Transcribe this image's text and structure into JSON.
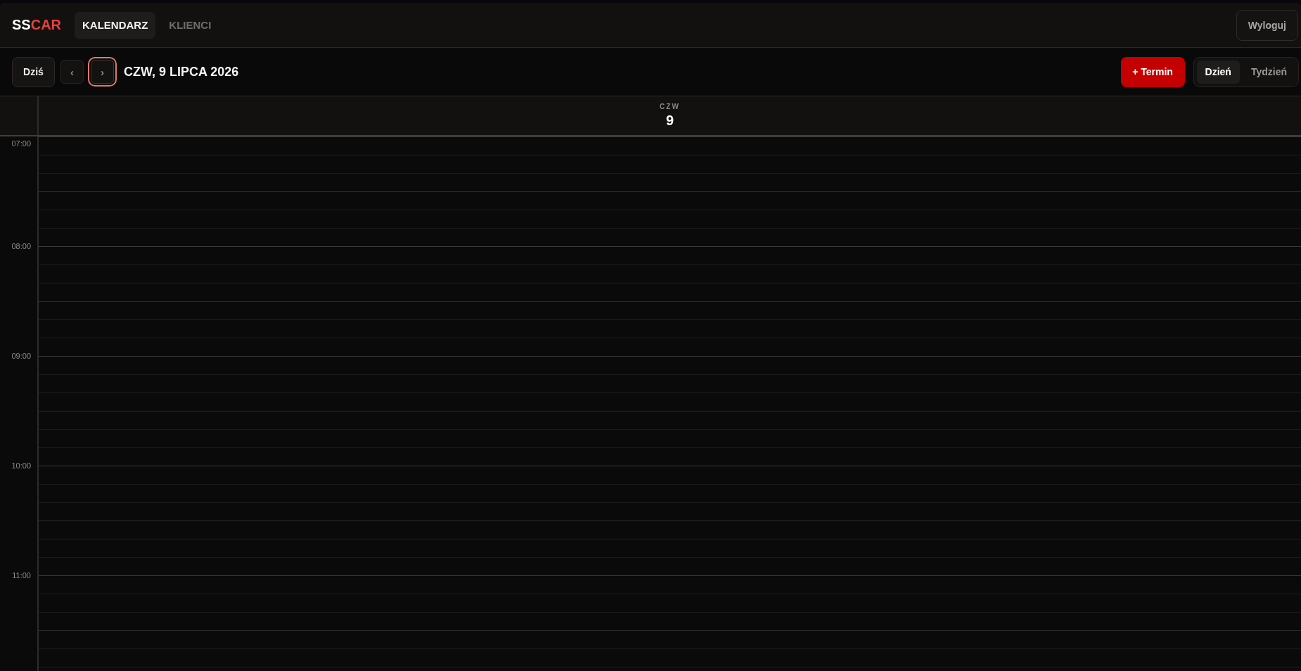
{
  "header": {
    "logo": {
      "primary": "SS",
      "accent": "CAR"
    },
    "nav": [
      {
        "label": "KALENDARZ",
        "selected": true
      },
      {
        "label": "KLIENCI",
        "selected": false
      }
    ],
    "logout": "Wyloguj"
  },
  "toolbar": {
    "today": "Dziś",
    "prev": {
      "label": "‹",
      "focused": false
    },
    "next": {
      "label": "›",
      "focused": true
    },
    "date_title": "CZW, 9 LIPCA 2026",
    "add": "+ Termin",
    "views": [
      {
        "label": "Dzień",
        "selected": true
      },
      {
        "label": "Tydzień",
        "selected": false
      }
    ]
  },
  "calendar": {
    "day_header": {
      "weekday": "CZW",
      "day": "9"
    },
    "time_labels": [
      "07:00",
      "08:00",
      "09:00",
      "10:00",
      "11:00"
    ]
  }
}
